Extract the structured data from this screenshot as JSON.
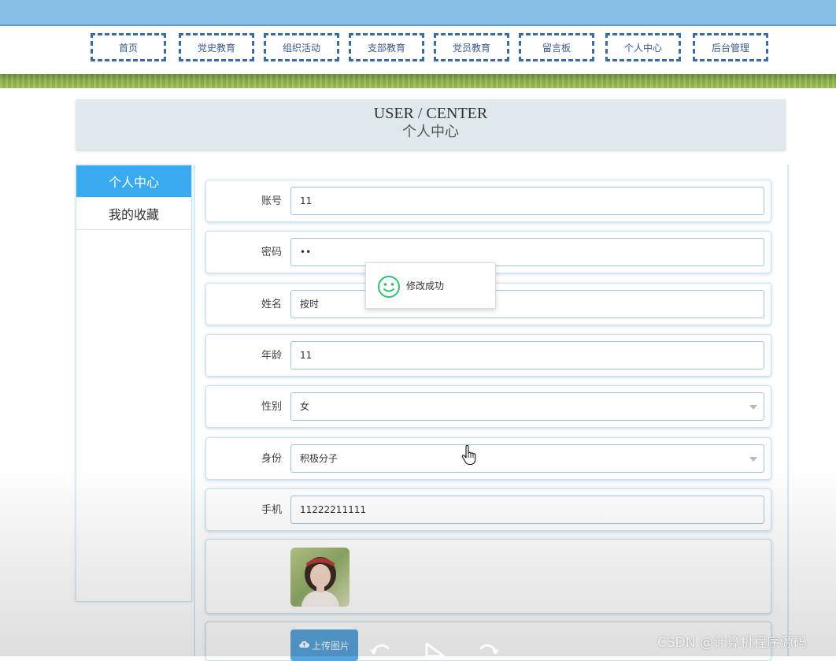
{
  "nav": {
    "items": [
      {
        "label": "首页"
      },
      {
        "label": "党史教育"
      },
      {
        "label": "组织活动"
      },
      {
        "label": "支部教育"
      },
      {
        "label": "党员教育"
      },
      {
        "label": "留言板"
      },
      {
        "label": "个人中心"
      },
      {
        "label": "后台管理"
      }
    ]
  },
  "page": {
    "title_en": "USER / CENTER",
    "title_cn": "个人中心"
  },
  "sidebar": {
    "items": [
      {
        "label": "个人中心",
        "active": true
      },
      {
        "label": "我的收藏",
        "active": false
      }
    ]
  },
  "form": {
    "account": {
      "label": "账号",
      "value": "11"
    },
    "password": {
      "label": "密码",
      "value": "••"
    },
    "name": {
      "label": "姓名",
      "value": "按时"
    },
    "age": {
      "label": "年龄",
      "value": "11"
    },
    "gender": {
      "label": "性别",
      "value": "女"
    },
    "identity": {
      "label": "身份",
      "value": "积极分子"
    },
    "phone": {
      "label": "手机",
      "value": "11222211111"
    },
    "upload_label": "上传图片"
  },
  "toast": {
    "message": "修改成功"
  },
  "watermark": "CSDN @计算机程序源码",
  "colors": {
    "nav_border": "#3d6aa8",
    "accent": "#3aaaf0",
    "toast_icon": "#2fbf71",
    "upload_button": "#58a5dd"
  }
}
